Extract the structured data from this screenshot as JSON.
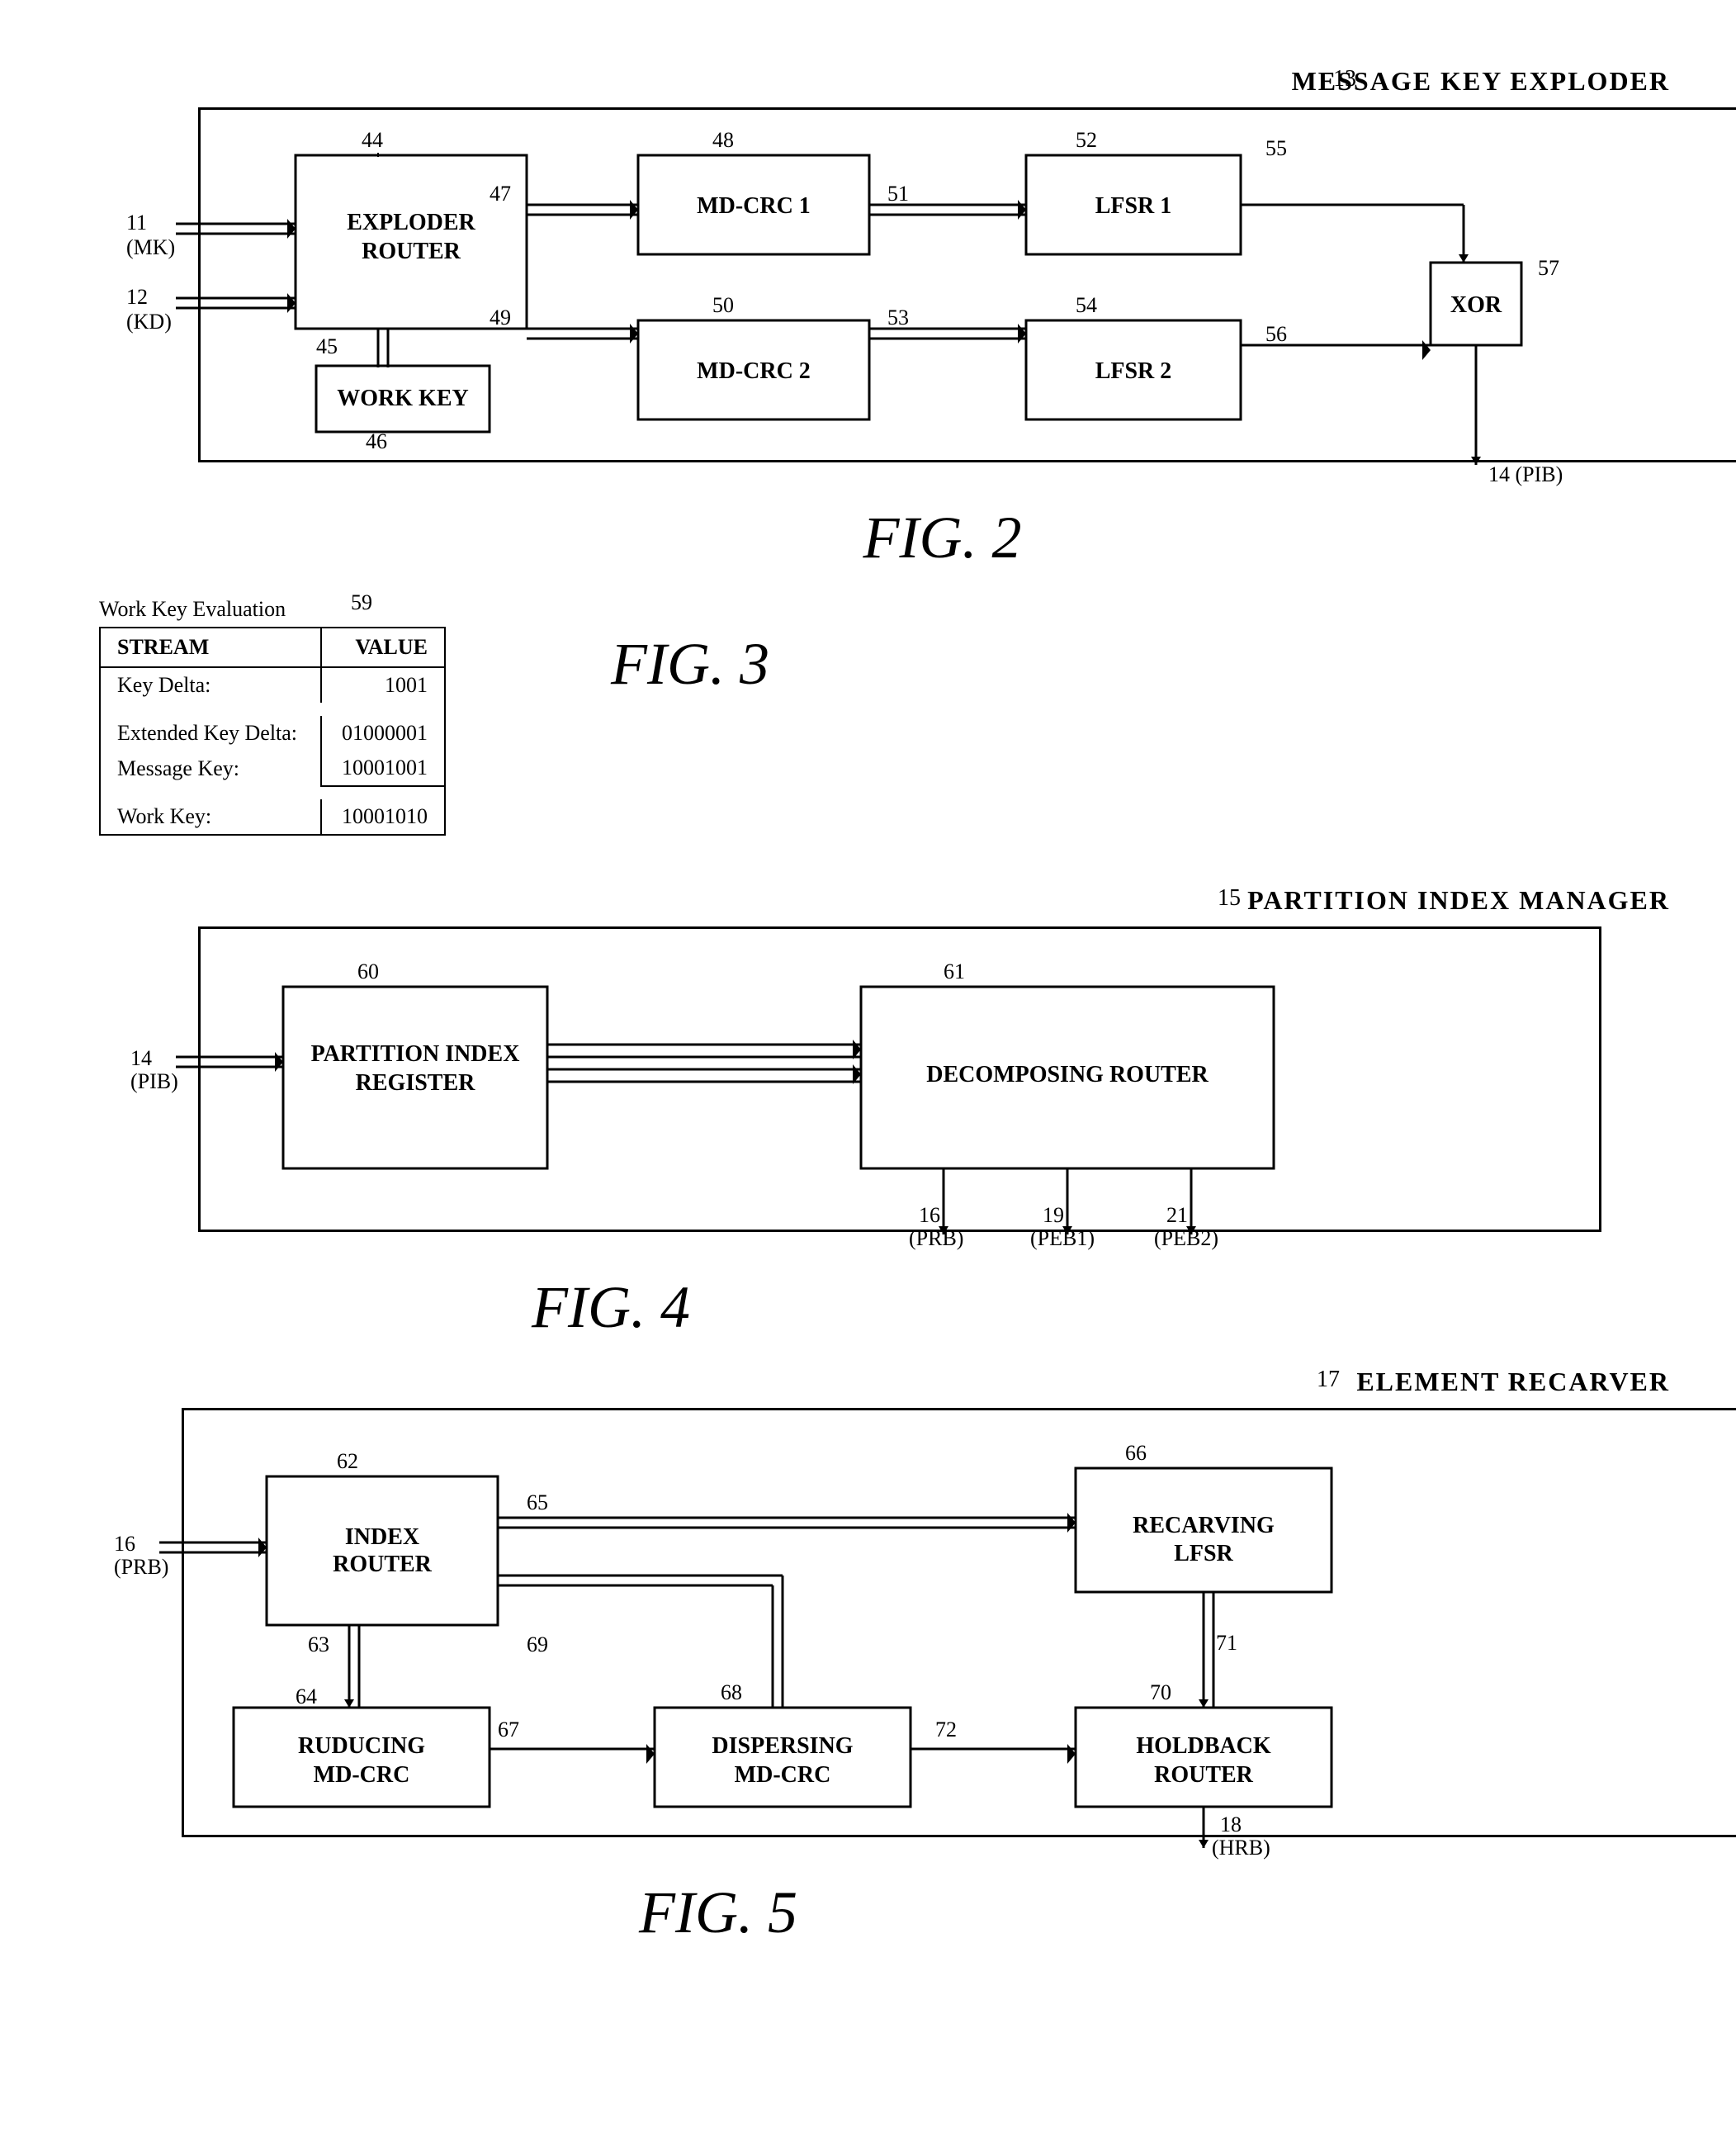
{
  "page": {
    "background": "#ffffff"
  },
  "fig2": {
    "title": "MESSAGE KEY EXPLODER",
    "title_ref": "13",
    "caption": "FIG. 2",
    "ref_pib": "14 (PIB)",
    "components": {
      "exploder_router": {
        "label": "EXPLODER\nROUTER",
        "ref": "44"
      },
      "work_key": {
        "label": "WORK KEY",
        "ref": "46"
      },
      "md_crc1": {
        "label": "MD-CRC 1",
        "ref": "48"
      },
      "md_crc2": {
        "label": "MD-CRC 2",
        "ref": "50"
      },
      "lfsr1": {
        "label": "LFSR 1",
        "ref": "52"
      },
      "lfsr2": {
        "label": "LFSR 2",
        "ref": "54"
      },
      "xor": {
        "label": "XOR",
        "ref": "57"
      }
    },
    "refs": {
      "mk_in": "11\n(MK)",
      "kd_in": "12\n(KD)",
      "r44": "44",
      "r45": "45",
      "r46": "46",
      "r47": "47",
      "r48": "48",
      "r49": "49",
      "r50": "50",
      "r51": "51",
      "r52": "52",
      "r53": "53",
      "r54": "54",
      "r55": "55",
      "r56": "56",
      "r57": "57"
    }
  },
  "fig3": {
    "title": "Work Key Evaluation",
    "ref": "59",
    "caption": "FIG. 3",
    "table": {
      "headers": [
        "STREAM",
        "VALUE"
      ],
      "rows": [
        {
          "stream": "Key Delta:",
          "value": "1001",
          "style": "normal"
        },
        {
          "stream": "",
          "value": "",
          "style": "blank"
        },
        {
          "stream": "Extended Key Delta:",
          "value": "01000001",
          "style": "normal"
        },
        {
          "stream": "Message Key:",
          "value": "10001001",
          "style": "underline"
        },
        {
          "stream": "",
          "value": "",
          "style": "blank"
        },
        {
          "stream": "Work Key:",
          "value": "10001010",
          "style": "normal"
        }
      ]
    }
  },
  "fig4": {
    "title": "PARTITION INDEX MANAGER",
    "title_ref": "15",
    "caption": "FIG. 4",
    "components": {
      "pir": {
        "label": "PARTITION INDEX\nREGISTER",
        "ref": "60"
      },
      "decomposing_router": {
        "label": "DECOMPOSING ROUTER",
        "ref": "61"
      }
    },
    "refs": {
      "pib_in": "14\n(PIB)",
      "r16": "16\n(PRB)",
      "r19": "19\n(PEB1)",
      "r21": "21\n(PEB2)"
    }
  },
  "fig5": {
    "title": "ELEMENT RECARVER",
    "title_ref": "17",
    "caption": "FIG. 5",
    "components": {
      "index_router": {
        "label": "INDEX\nROUTER",
        "ref": "62"
      },
      "recarving_lfsr": {
        "label": "RECARVING\nLFSR",
        "ref": "66"
      },
      "ruducing_md_crc": {
        "label": "RUDUCING\nMD-CRC",
        "ref": "64"
      },
      "dispersing_md_crc": {
        "label": "DISPERSING\nMD-CRC",
        "ref": "68"
      },
      "holdback_router": {
        "label": "HOLDBACK\nROUTER",
        "ref": "70"
      }
    },
    "refs": {
      "prb_in": "16\n(PRB)",
      "r62": "62",
      "r63": "63",
      "r64": "64",
      "r65": "65",
      "r66": "66",
      "r67": "67",
      "r68": "68",
      "r69": "69",
      "r70": "70",
      "r71": "71",
      "r72": "72",
      "hrb_out": "18\n(HRB)"
    }
  }
}
